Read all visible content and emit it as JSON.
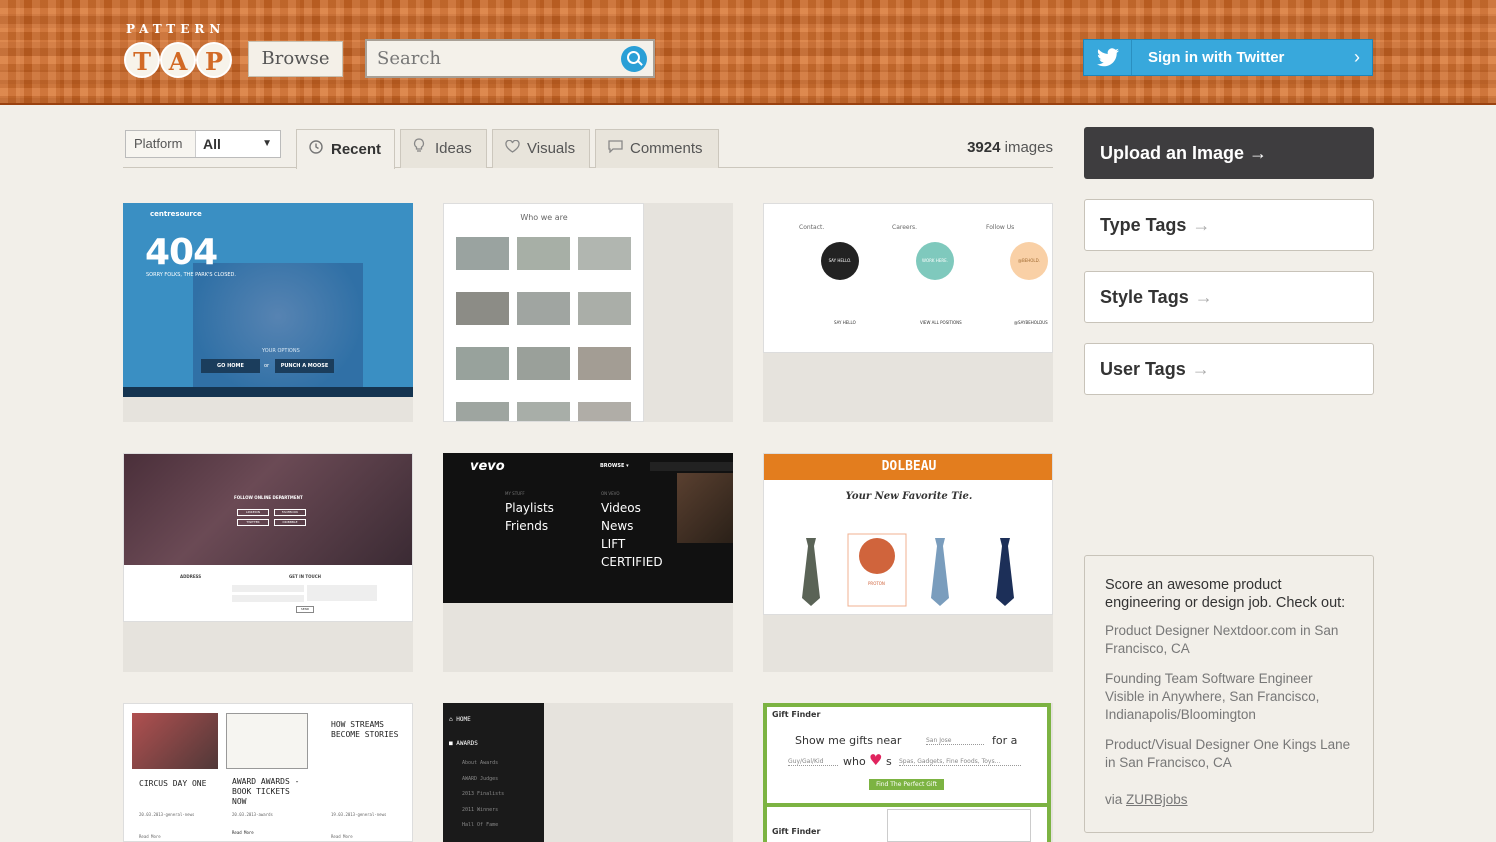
{
  "header": {
    "logo_top": "PATTERN",
    "logo_letters": [
      "T",
      "A",
      "P"
    ],
    "browse_label": "Browse",
    "search_placeholder": "Search",
    "twitter_label": "Sign in with Twitter",
    "twitter_arrow": "›"
  },
  "filter": {
    "platform_label": "Platform",
    "platform_value": "All",
    "tabs": [
      {
        "label": "Recent",
        "icon": "clock-icon",
        "glyph": "◷"
      },
      {
        "label": "Ideas",
        "icon": "lightbulb-icon",
        "glyph": "♡"
      },
      {
        "label": "Visuals",
        "icon": "heart-icon",
        "glyph": "♡"
      },
      {
        "label": "Comments",
        "icon": "comment-icon",
        "glyph": "▭"
      }
    ],
    "count_number": "3924",
    "count_suffix": " images"
  },
  "shots": {
    "s1": {
      "brand": "centresource",
      "big": "404",
      "sub": "SORRY FOLKS, THE PARK'S CLOSED.",
      "options": "YOUR OPTIONS",
      "btn1": "GO HOME",
      "or": "or",
      "btn2": "PUNCH A MOOSE"
    },
    "s2": {
      "title": "Who we are"
    },
    "s3": {
      "col1": "Contact.",
      "col2": "Careers.",
      "col3": "Follow Us",
      "c1": "SAY HELLO.",
      "c2": "WORK HERE.",
      "c3": "@BEHOLD.",
      "l1": "SAY HELLO",
      "l2": "VIEW ALL POSITIONS",
      "l3": "@SAYBEHOLDUS"
    },
    "s4": {
      "heading": "FOLLOW ONLINE DEPARTMENT",
      "b1": "LINKEDIN",
      "b2": "FACEBOOK",
      "b3": "TWITTER",
      "b4": "DRIBBBLE",
      "address": "ADDRESS",
      "touch": "GET IN TOUCH",
      "send": "SEND"
    },
    "s5": {
      "logo": "vevo",
      "browse": "BROWSE ▾",
      "l1": "Playlists",
      "l2": "Friends",
      "r1": "Videos",
      "r2": "News",
      "r3": "LIFT",
      "r4": "CERTIFIED",
      "mystuff": "MY STUFF",
      "onvevo": "ON VEVO"
    },
    "s6": {
      "brand": "DOLBEAU",
      "tag": "Your New Favorite Tie.",
      "proto": "PROTON"
    },
    "s7": {
      "a": "CIRCUS DAY ONE",
      "b": "AWARD AWARDS - BOOK TICKETS NOW",
      "c": "HOW STREAMS BECOME STORIES",
      "d1": "20.03.2013-general-news",
      "d2": "20.03.2013-awards",
      "d3": "19.03.2013-general-news",
      "r1": "Read More",
      "r2": "Read More",
      "r3": "Read More"
    },
    "s8": {
      "home": "HOME",
      "awards": "AWARDS",
      "i1": "About Awards",
      "i2": "AWARD Judges",
      "i3": "2013 Finalists",
      "i4": "2011 Winners",
      "i5": "Hall Of Fame"
    },
    "s9": {
      "title": "Gift Finder",
      "line1a": "Show me gifts near",
      "loc": "San Jose",
      "line1b": "for a",
      "who": "Guy/Gal/Kid",
      "line2": "who",
      "s": "s",
      "likes": "Spas, Gadgets, Fine Foods, Toys...",
      "btn": "Find The Perfect Gift",
      "title2": "Gift Finder"
    }
  },
  "sidebar": {
    "upload_label": "Upload an Image",
    "tags": [
      "Type Tags",
      "Style Tags",
      "User Tags"
    ],
    "jobs_intro": "Score an awesome product engineering or design job. Check out:",
    "jobs": [
      "Product Designer Nextdoor.com in San Francisco, CA",
      "Founding Team Software Engineer Visible in Anywhere, San Francisco, Indianapolis/Bloomington",
      "Product/Visual Designer One Kings Lane in San Francisco, CA"
    ],
    "via_prefix": "via ",
    "via_link": "ZURBjobs"
  },
  "colors": {
    "accent": "#d26a26",
    "twitter": "#38a8dc",
    "search": "#2a9fd6",
    "upload": "#3e3d3f"
  }
}
